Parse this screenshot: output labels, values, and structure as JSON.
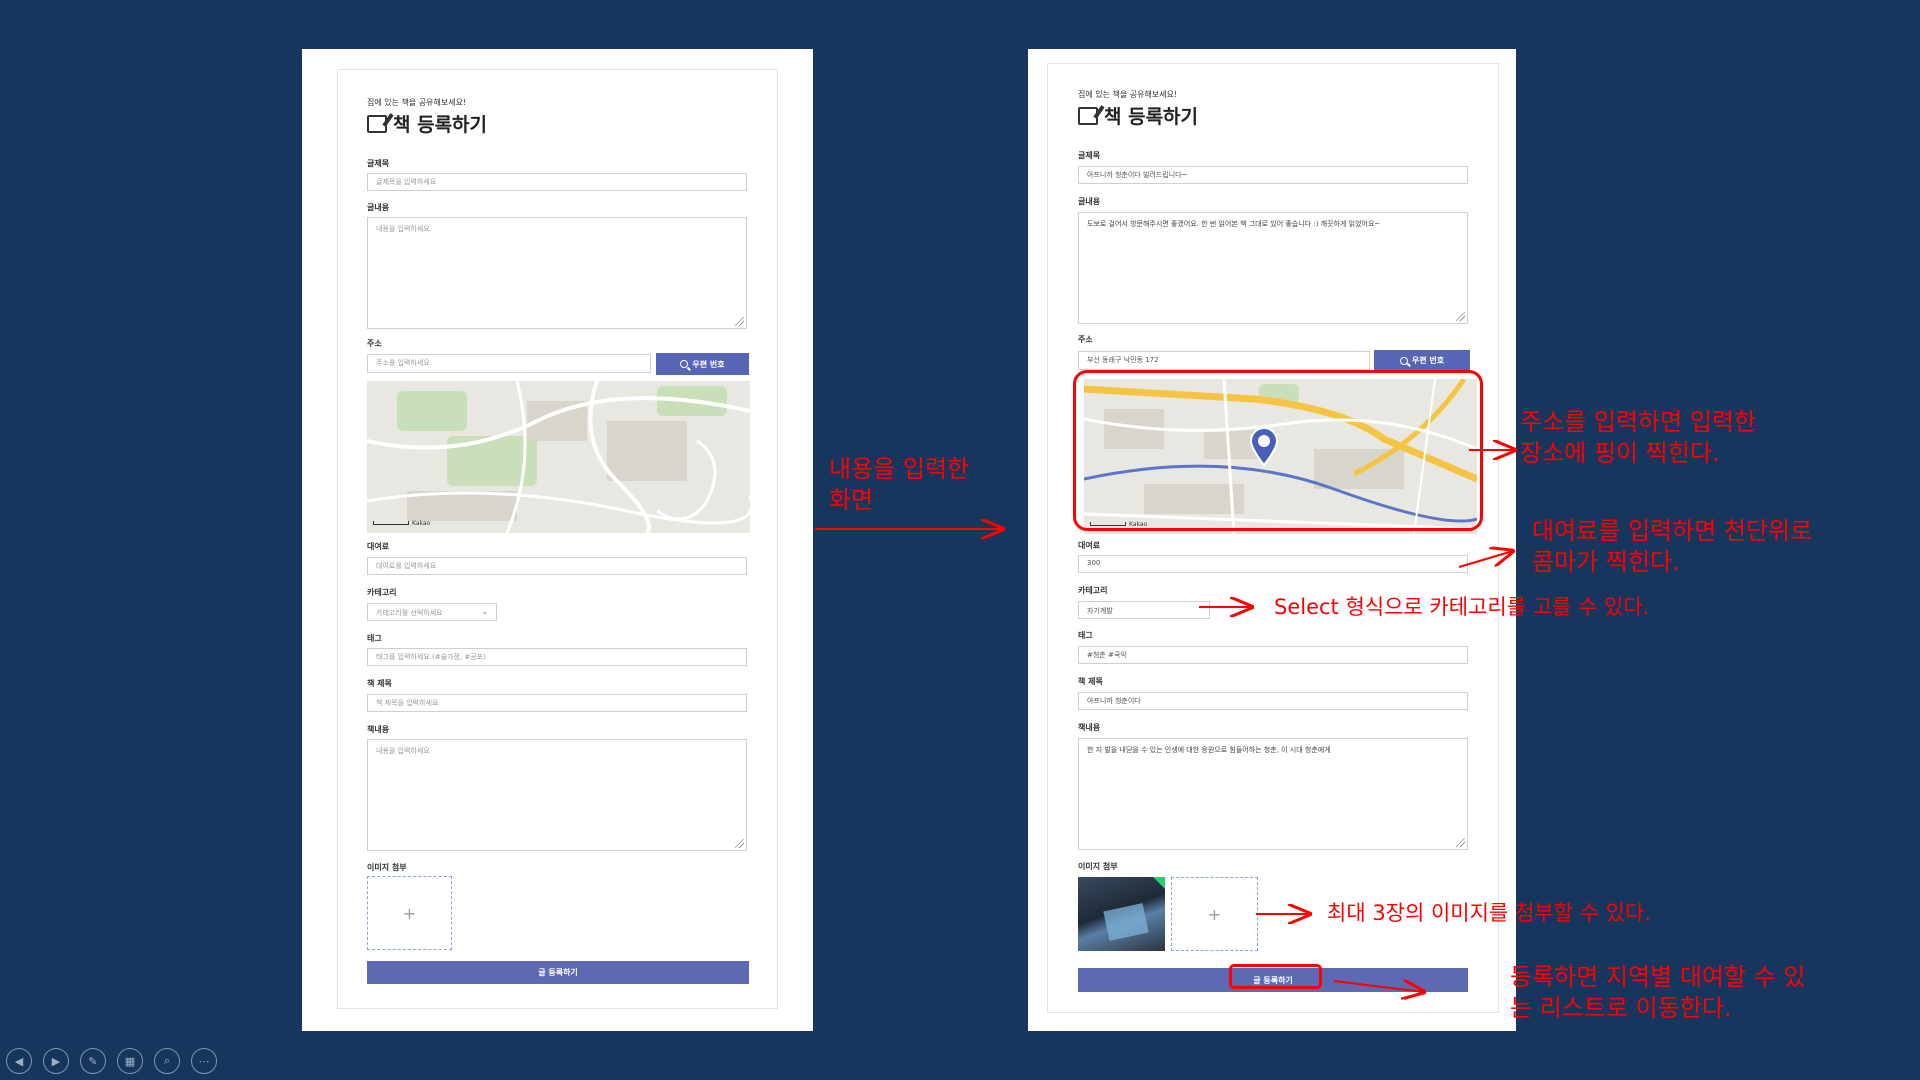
{
  "slide": {
    "caption_middle": [
      "내용을 입력한",
      "화면"
    ],
    "annotations": {
      "map_pin": [
        "주소를 입력하면 입력한",
        "장소에 핑이 찍힌다."
      ],
      "fee_comma": [
        "대여료를 입력하면 천단위로",
        "콤마가 찍힌다."
      ],
      "select_category": "Select 형식으로 카테고리를 고를 수 있다.",
      "image_limit": "최대 3장의 이미지를 첨부할 수 있다.",
      "submit_redirect": [
        "등록하면 지역별 대여할 수 있",
        "는 리스트로 이동한다."
      ]
    },
    "colors": {
      "background": "#17365d",
      "annotation": "#ff0000",
      "button": "#5d69b3"
    }
  },
  "form_empty": {
    "subtitle": "집에 있는 책을 공유해보세요!",
    "title": "책 등록하기",
    "labels": {
      "post_title": "글제목",
      "post_content": "글내용",
      "address": "주소",
      "fee": "대여료",
      "category": "카테고리",
      "tag": "태그",
      "book_title": "책 제목",
      "book_content": "책내용",
      "images": "이미지 첨부"
    },
    "placeholders": {
      "post_title": "글제목을 입력하세요",
      "post_content": "내용을 입력하세요",
      "address": "주소를 입력하세요",
      "fee": "대여료를 입력하세요",
      "category": "카테고리를 선택하세요",
      "tag": "태그를 입력하세요 (#술가정, #공포)",
      "book_title": "책 제목을 입력하세요",
      "book_content": "내용을 입력하세요"
    },
    "zip_button": "우편 번호",
    "submit_button": "글 등록하기",
    "map_label": "Kakao",
    "upload_plus": "+"
  },
  "form_filled": {
    "subtitle": "집에 있는 책을 공유해보세요!",
    "title": "책 등록하기",
    "labels": {
      "post_title": "글제목",
      "post_content": "글내용",
      "address": "주소",
      "fee": "대여료",
      "category": "카테고리",
      "tag": "태그",
      "book_title": "책 제목",
      "book_content": "책내용",
      "images": "이미지 첨부"
    },
    "values": {
      "post_title": "아프니까 청춘이다 빌려드립니다~",
      "post_content": "도보로 걸어서 방문해주시면 좋겠어요. 한 번 읽어본 책 그대로 있어 좋습니다 :) 깨끗하게 읽었어요~",
      "address": "부산 동래구 낙민동 172",
      "fee": "300",
      "category": "자기계발",
      "tag": "#청춘 #국악",
      "book_title": "아프니까 청춘이다",
      "book_content": "한 지 발을 내딛을 수 있는 인생에 대한 응원으로 힘들어하는 청춘, 이 시대 청춘에게"
    },
    "zip_button": "우편 번호",
    "submit_button": "글 등록하기",
    "map_label": "Kakao",
    "upload_plus": "+"
  }
}
